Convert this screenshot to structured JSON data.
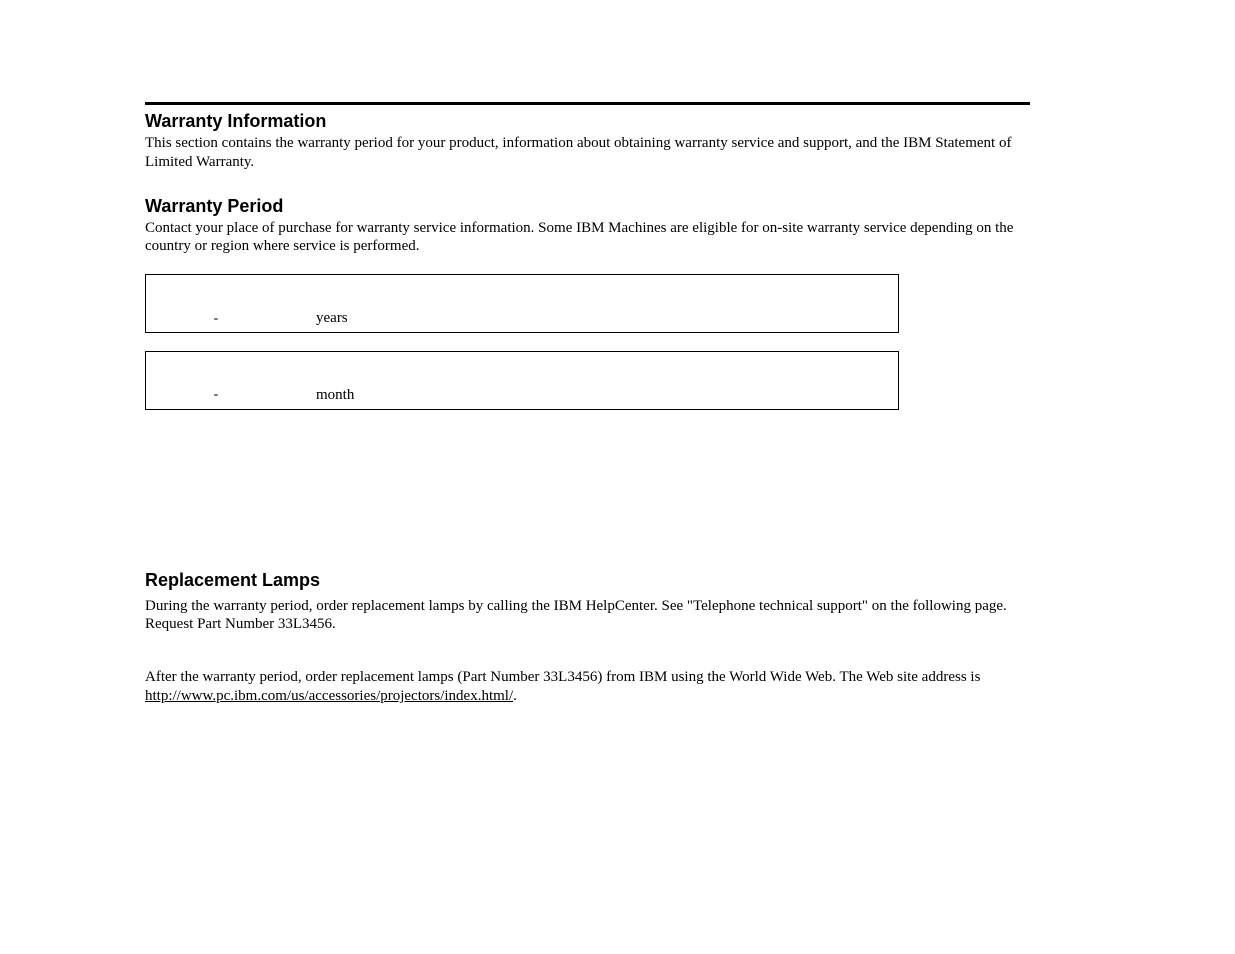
{
  "section1": {
    "heading": "Warranty Information",
    "body": "This section contains the warranty period for your product, information about obtaining warranty service and support, and the IBM Statement of Limited Warranty."
  },
  "section2": {
    "heading": "Warranty Period",
    "body": "Contact your place of purchase for warranty service information. Some IBM Machines are eligible for on-site warranty service depending on the country or region where service is performed."
  },
  "table1": {
    "dash": "-",
    "label": "years"
  },
  "table2": {
    "dash": "-",
    "label": "month"
  },
  "section3": {
    "heading": "Replacement Lamps",
    "para1": "During the warranty period, order replacement lamps by calling the IBM HelpCenter.  See \"Telephone technical support\"  on the following page.  Request Part Number 33L3456.",
    "para2_pre": "After the warranty period, order replacement lamps (Part Number 33L3456) from IBM using the World Wide Web.  The Web site address is ",
    "para2_link": "http://www.pc.ibm.com/us/accessories/projectors/index.html/",
    "para2_post": "."
  }
}
